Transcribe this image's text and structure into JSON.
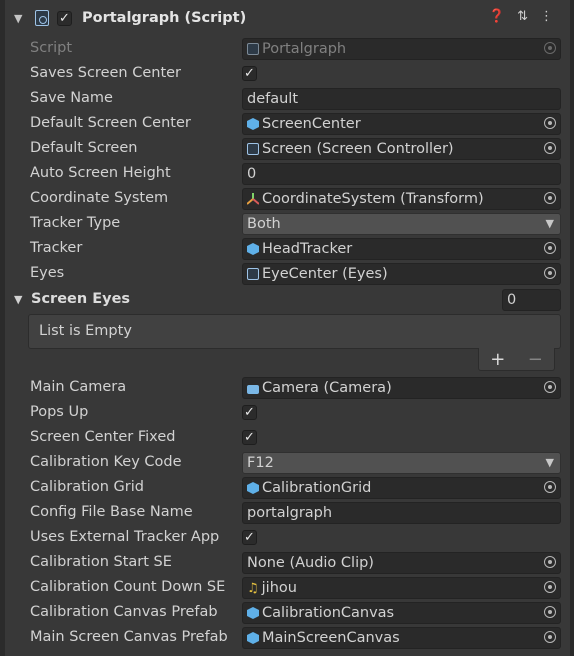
{
  "component": {
    "title": "Portalgraph (Script)",
    "enabled": "✓"
  },
  "header_icons": [
    "help-icon",
    "preset-icon",
    "more-icon"
  ],
  "rows": [
    {
      "label": "Script",
      "value": "Portalgraph"
    },
    {
      "label": "Saves Screen Center",
      "checked": "✓"
    },
    {
      "label": "Save Name",
      "value": "default"
    },
    {
      "label": "Default Screen Center",
      "value": "ScreenCenter"
    },
    {
      "label": "Default Screen",
      "value": "Screen (Screen Controller)"
    },
    {
      "label": "Auto Screen Height",
      "value": "0"
    },
    {
      "label": "Coordinate System",
      "value": "CoordinateSystem (Transform)"
    },
    {
      "label": "Tracker Type",
      "value": "Both"
    },
    {
      "label": "Tracker",
      "value": "HeadTracker"
    },
    {
      "label": "Eyes",
      "value": "EyeCenter (Eyes)"
    },
    {
      "label": "Main Camera",
      "value": "Camera (Camera)"
    },
    {
      "label": "Pops Up",
      "checked": "✓"
    },
    {
      "label": "Screen Center Fixed",
      "checked": "✓"
    },
    {
      "label": "Calibration Key Code",
      "value": "F12"
    },
    {
      "label": "Calibration Grid",
      "value": "CalibrationGrid"
    },
    {
      "label": "Config File Base Name",
      "value": "portalgraph"
    },
    {
      "label": "Uses External Tracker App",
      "checked": "✓"
    },
    {
      "label": "Calibration Start SE",
      "value": "None (Audio Clip)"
    },
    {
      "label": "Calibration Count Down SE",
      "value": "jihou"
    },
    {
      "label": "Calibration Canvas Prefab",
      "value": "CalibrationCanvas"
    },
    {
      "label": "Main Screen Canvas Prefab",
      "value": "MainScreenCanvas"
    }
  ],
  "screen_eyes": {
    "label": "Screen Eyes",
    "count": "0",
    "empty_text": "List is Empty",
    "add": "+",
    "remove": "−"
  },
  "colors": {
    "background": "#383838",
    "field": "#2a2a2a",
    "dropdown": "#515151",
    "text": "#d2d2d2"
  }
}
